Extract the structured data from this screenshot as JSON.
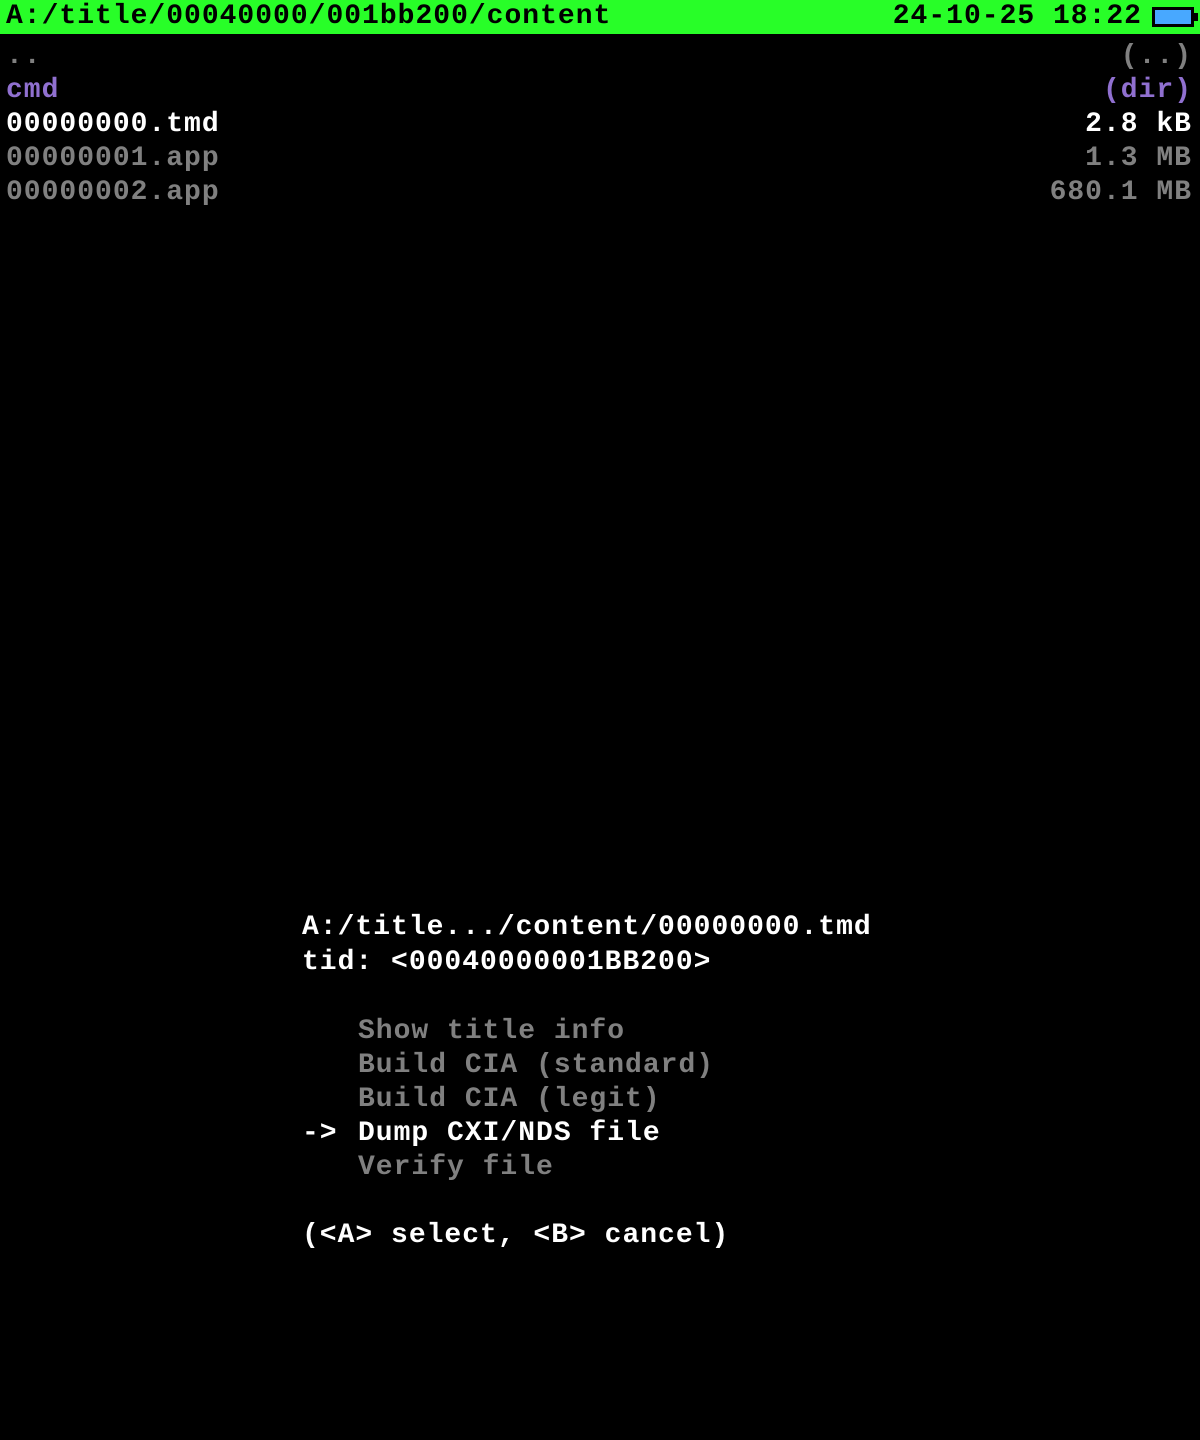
{
  "header": {
    "path": "A:/title/00040000/001bb200/content",
    "datetime": "24-10-25 18:22"
  },
  "files": {
    "items": [
      {
        "name": "..",
        "size": "(..)",
        "color": "dim"
      },
      {
        "name": "cmd",
        "size": "(dir)",
        "color": "purple"
      },
      {
        "name": "00000000.tmd",
        "size": "2.8 kB",
        "color": "white"
      },
      {
        "name": "00000001.app",
        "size": "1.3 MB",
        "color": "dim"
      },
      {
        "name": "00000002.app",
        "size": "680.1 MB",
        "color": "dim"
      }
    ]
  },
  "menu": {
    "header_line1": "A:/title.../content/00000000.tmd",
    "header_line2": "tid: <00040000001BB200>",
    "arrow": "->",
    "items": [
      {
        "label": "Show title info",
        "selected": false
      },
      {
        "label": "Build CIA (standard)",
        "selected": false
      },
      {
        "label": "Build CIA (legit)",
        "selected": false
      },
      {
        "label": "Dump CXI/NDS file",
        "selected": true
      },
      {
        "label": "Verify file",
        "selected": false
      }
    ],
    "footer": "(<A> select, <B> cancel)"
  }
}
